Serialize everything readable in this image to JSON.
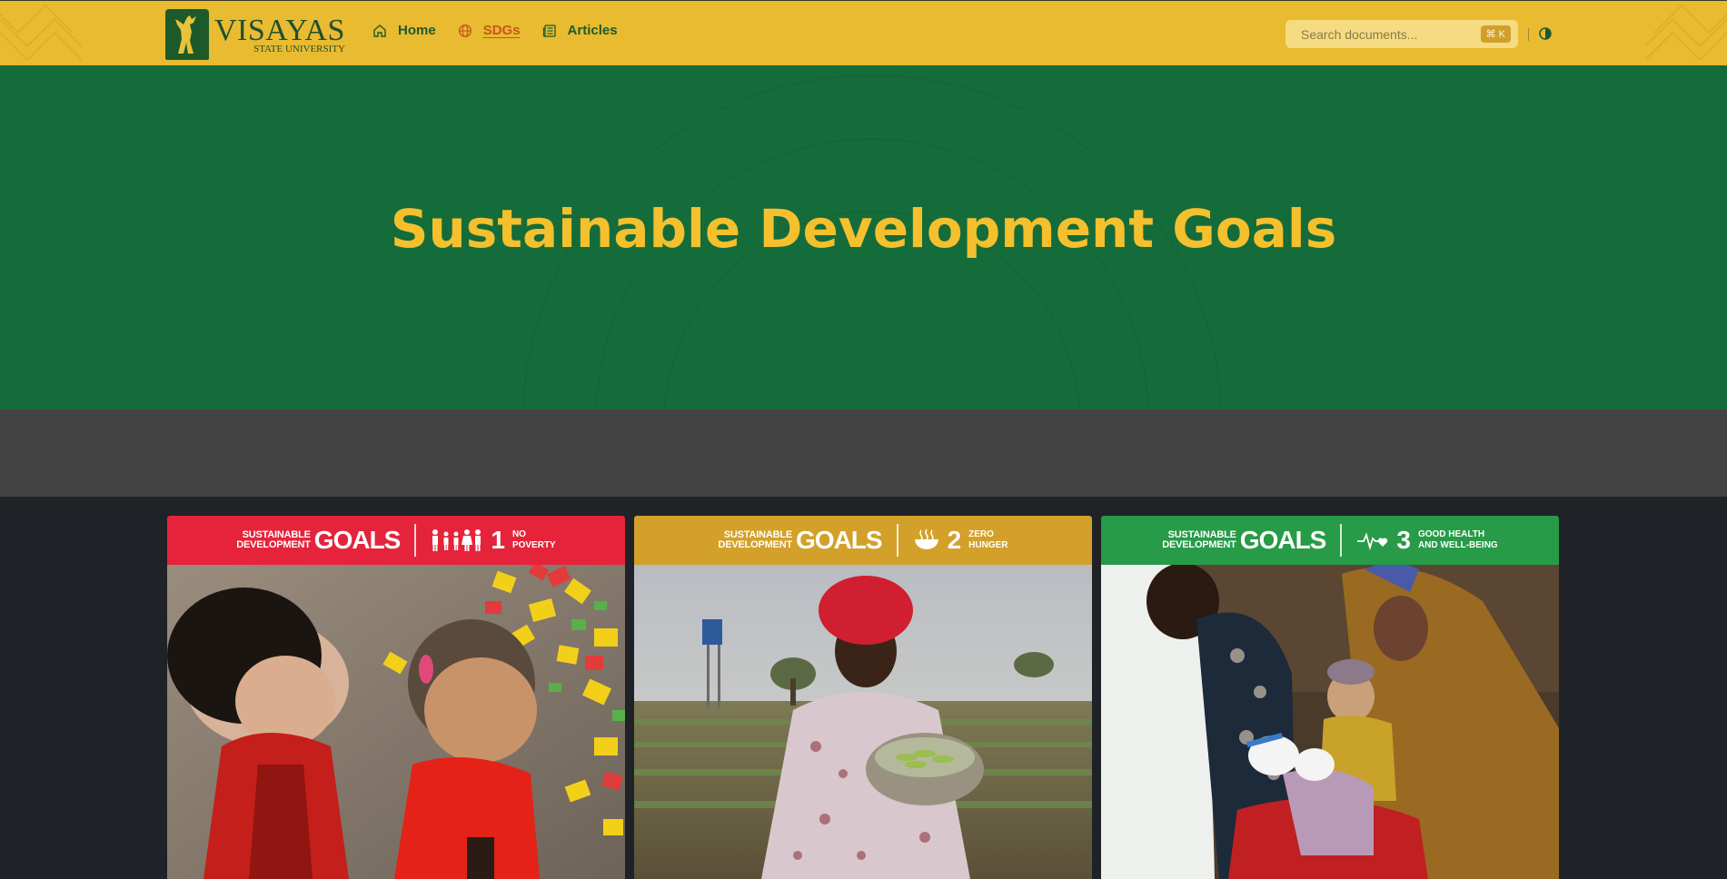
{
  "header": {
    "logo": {
      "main": "VISAYAS",
      "sub": "STATE UNIVERSITY"
    },
    "nav": [
      {
        "label": "Home",
        "icon": "home-icon",
        "active": false
      },
      {
        "label": "SDGs",
        "icon": "globe-icon",
        "active": true
      },
      {
        "label": "Articles",
        "icon": "newspaper-icon",
        "active": false
      }
    ],
    "search": {
      "placeholder": "Search documents...",
      "shortcut": "⌘ K"
    },
    "theme_icon": "theme-toggle-icon"
  },
  "hero": {
    "title": "Sustainable Development Goals"
  },
  "cards": [
    {
      "brand_small_1": "SUSTAINABLE",
      "brand_small_2": "DEVELOPMENT",
      "brand_goals": "GOALS",
      "number": "1",
      "name_1": "NO",
      "name_2": "POVERTY",
      "color": "#e5243b",
      "icon": "family-icon"
    },
    {
      "brand_small_1": "SUSTAINABLE",
      "brand_small_2": "DEVELOPMENT",
      "brand_goals": "GOALS",
      "number": "2",
      "name_1": "ZERO",
      "name_2": "HUNGER",
      "color": "#d3a029",
      "icon": "bowl-icon"
    },
    {
      "brand_small_1": "SUSTAINABLE",
      "brand_small_2": "DEVELOPMENT",
      "brand_goals": "GOALS",
      "number": "3",
      "name_1": "GOOD HEALTH",
      "name_2": "AND WELL-BEING",
      "color": "#279b48",
      "icon": "heartbeat-icon"
    }
  ],
  "colors": {
    "header_bg": "#e8bb30",
    "hero_bg": "#156c3b",
    "title": "#f4c02d",
    "band": "#424242",
    "page_bg": "#1f2227",
    "nav_text": "#1e5a2e",
    "nav_active": "#c8561c"
  }
}
